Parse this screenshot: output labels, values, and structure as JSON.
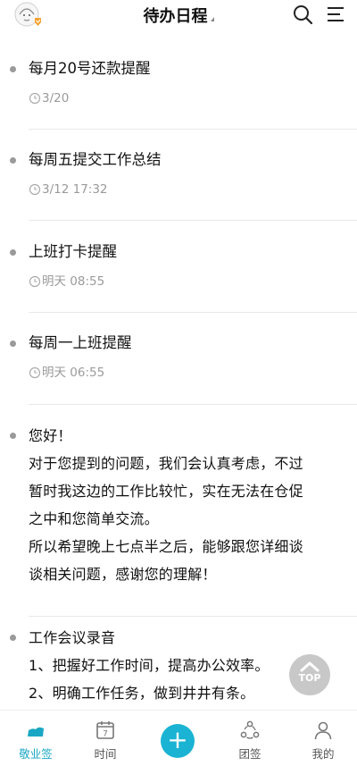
{
  "header": {
    "title": "待办日程"
  },
  "items": [
    {
      "title": "每月20号还款提醒",
      "time": "3/20"
    },
    {
      "title": "每周五提交工作总结",
      "time": "3/12 17:32"
    },
    {
      "title": "上班打卡提醒",
      "time": "明天 08:55"
    },
    {
      "title": "每周一上班提醒",
      "time": "明天 06:55"
    }
  ],
  "note": {
    "lines": [
      "您好！",
      "对于您提到的问题，我们会认真考虑，不过",
      "暂时我这边的工作比较忙，实在无法在仓促",
      "之中和您简单交流。",
      "所以希望晚上七点半之后，能够跟您详细谈",
      "谈相关问题，感谢您的理解！"
    ]
  },
  "meeting": {
    "lines": [
      "工作会议录音",
      "1、把握好工作时间，提高办公效率。",
      "2、明确工作任务，做到井井有条。"
    ]
  },
  "top_button": {
    "label": "TOP"
  },
  "calendar_day": "7",
  "tabs": [
    {
      "label": "敬业签",
      "icon": "cloud-note-icon",
      "active": true
    },
    {
      "label": "时间",
      "icon": "calendar-icon",
      "active": false
    },
    {
      "label": "团签",
      "icon": "group-icon",
      "active": false
    },
    {
      "label": "我的",
      "icon": "user-icon",
      "active": false
    }
  ],
  "colors": {
    "accent": "#1aa7c4",
    "plus": "#1ab3d3",
    "bullet": "#9a9a9a"
  }
}
